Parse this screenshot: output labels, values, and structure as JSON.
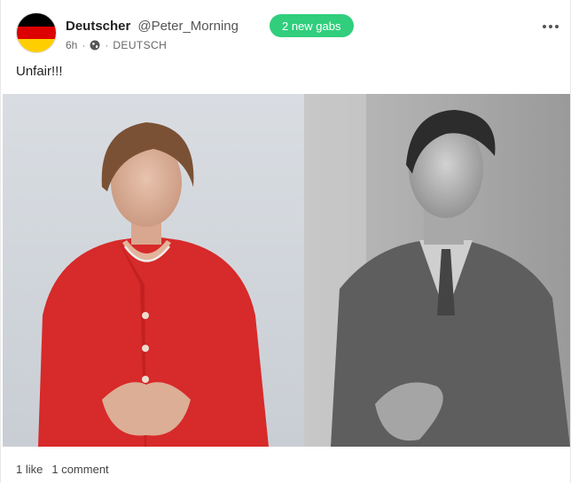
{
  "post": {
    "display_name": "Deutscher",
    "username": "@Peter_Morning",
    "time": "6h",
    "dot": "·",
    "language": "DEUTSCH",
    "text": "Unfair!!!",
    "new_gabs_label": "2 new gabs",
    "stats": {
      "likes": "1 like",
      "comments": "1 comment"
    },
    "visibility_icon": "globe-icon",
    "more_icon": "ellipsis-icon",
    "avatar_flag_colors": [
      "#000000",
      "#dd0000",
      "#ffce00"
    ]
  },
  "colors": {
    "accent_green": "#30ce7d"
  }
}
